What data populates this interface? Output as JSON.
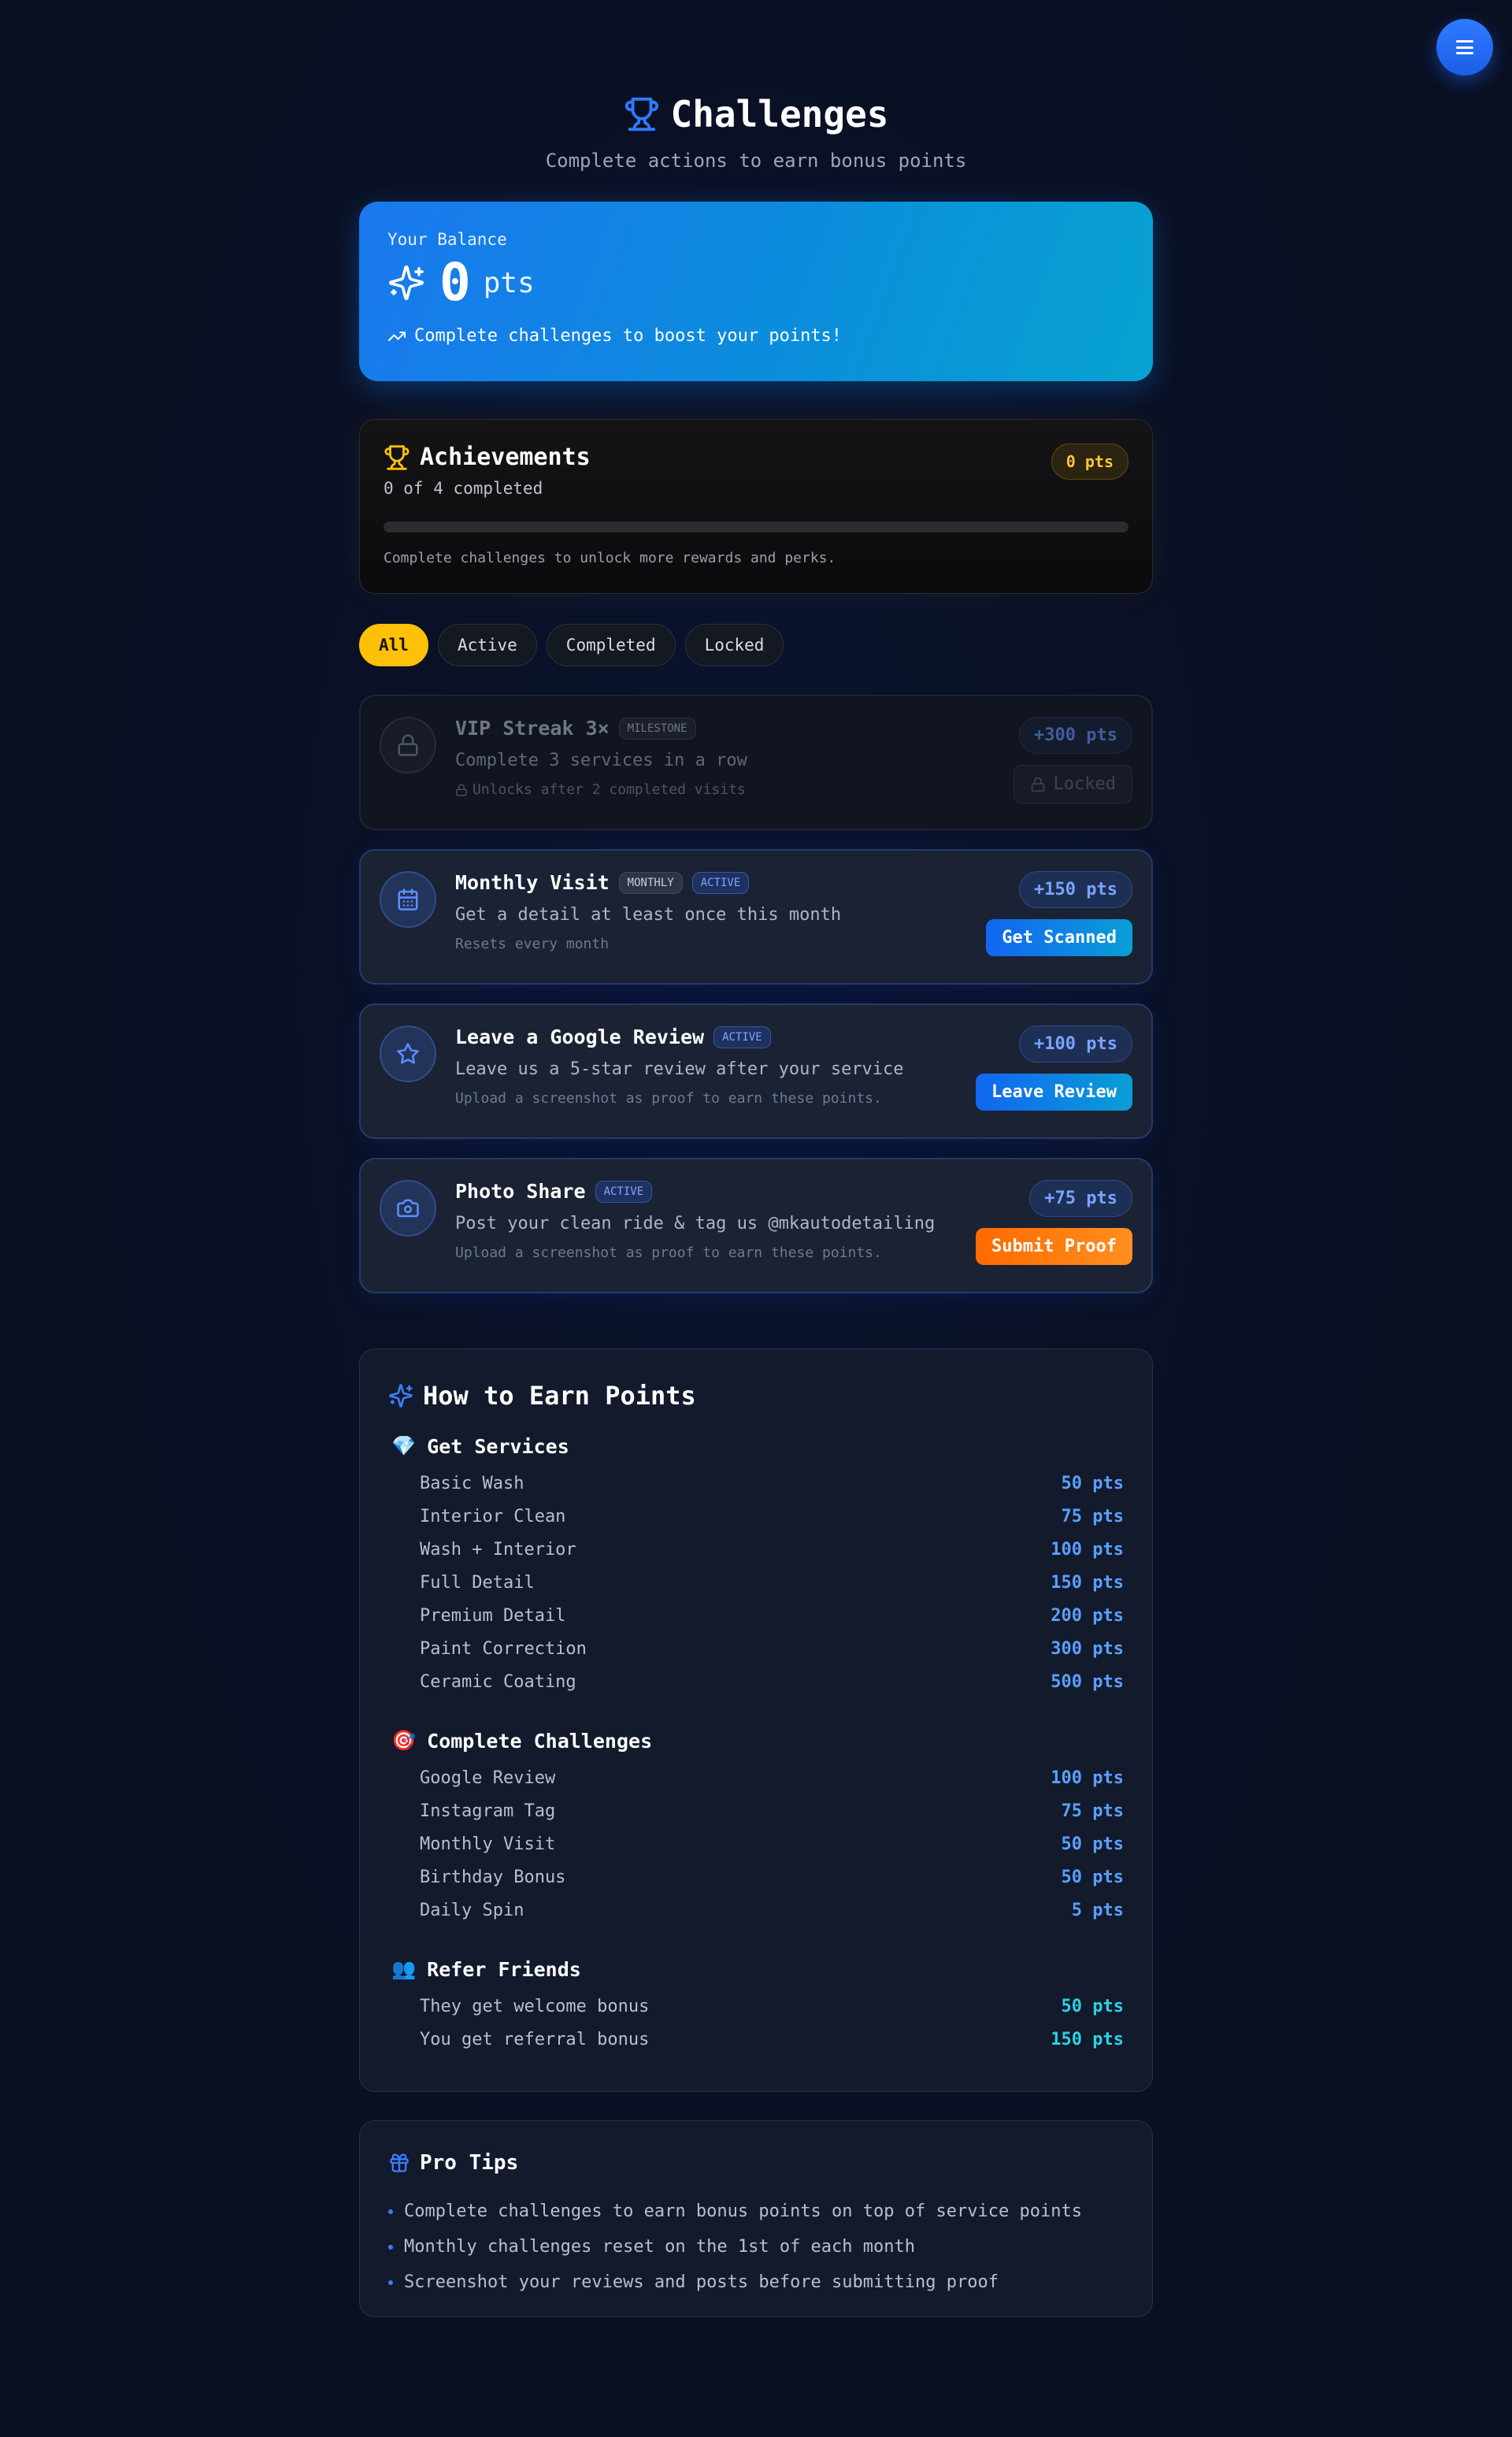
{
  "header": {
    "title": "Challenges",
    "subtitle": "Complete actions to earn bonus points"
  },
  "balance": {
    "label": "Your Balance",
    "value": "0",
    "unit": "pts",
    "hint": "Complete challenges to boost your points!"
  },
  "achievements": {
    "title": "Achievements",
    "count": "0 of 4 completed",
    "badge": "0 pts",
    "progress": 0,
    "note": "Complete challenges to unlock more rewards and perks."
  },
  "filters": [
    "All",
    "Active",
    "Completed",
    "Locked"
  ],
  "challenges": [
    {
      "title": "VIP Streak 3×",
      "tags": [
        "MILESTONE"
      ],
      "description": "Complete 3 services in a row",
      "note": "Unlocks after 2 completed visits",
      "points": "+300 pts",
      "action": "Locked",
      "icon": "lock-icon"
    },
    {
      "title": "Monthly Visit",
      "tags": [
        "MONTHLY",
        "ACTIVE"
      ],
      "description": "Get a detail at least once this month",
      "note": "Resets every month",
      "points": "+150 pts",
      "action": "Get Scanned",
      "icon": "calendar-icon"
    },
    {
      "title": "Leave a Google Review",
      "tags": [
        "ACTIVE"
      ],
      "description": "Leave us a 5-star review after your service",
      "note": "Upload a screenshot as proof to earn these points.",
      "points": "+100 pts",
      "action": "Leave Review",
      "icon": "star-icon"
    },
    {
      "title": "Photo Share",
      "tags": [
        "ACTIVE"
      ],
      "description": "Post your clean ride & tag us @mkautodetailing",
      "note": "Upload a screenshot as proof to earn these points.",
      "points": "+75 pts",
      "action": "Submit Proof",
      "icon": "camera-icon"
    }
  ],
  "earn": {
    "title": "How to Earn Points",
    "groups": [
      {
        "title": "Get Services",
        "emoji": "💎",
        "rows": [
          {
            "label": "Basic Wash",
            "value": "50 pts"
          },
          {
            "label": "Interior Clean",
            "value": "75 pts"
          },
          {
            "label": "Wash + Interior",
            "value": "100 pts"
          },
          {
            "label": "Full Detail",
            "value": "150 pts"
          },
          {
            "label": "Premium Detail",
            "value": "200 pts"
          },
          {
            "label": "Paint Correction",
            "value": "300 pts"
          },
          {
            "label": "Ceramic Coating",
            "value": "500 pts"
          }
        ]
      },
      {
        "title": "Complete Challenges",
        "emoji": "🎯",
        "rows": [
          {
            "label": "Google Review",
            "value": "100 pts"
          },
          {
            "label": "Instagram Tag",
            "value": "75 pts"
          },
          {
            "label": "Monthly Visit",
            "value": "50 pts"
          },
          {
            "label": "Birthday Bonus",
            "value": "50 pts"
          },
          {
            "label": "Daily Spin",
            "value": "5 pts"
          }
        ]
      },
      {
        "title": "Refer Friends",
        "emoji": "👥",
        "rows": [
          {
            "label": "They get welcome bonus",
            "value": "50 pts"
          },
          {
            "label": "You get referral bonus",
            "value": "150 pts"
          }
        ]
      }
    ]
  },
  "tips": {
    "title": "Pro Tips",
    "items": [
      "Complete challenges to earn bonus points on top of service points",
      "Monthly challenges reset on the 1st of each month",
      "Screenshot your reviews and posts before submitting proof"
    ]
  },
  "colors": {
    "accent": "#1a78ee",
    "gold": "#ffc107",
    "orange": "#ff6a00",
    "background": "#0a1024"
  }
}
